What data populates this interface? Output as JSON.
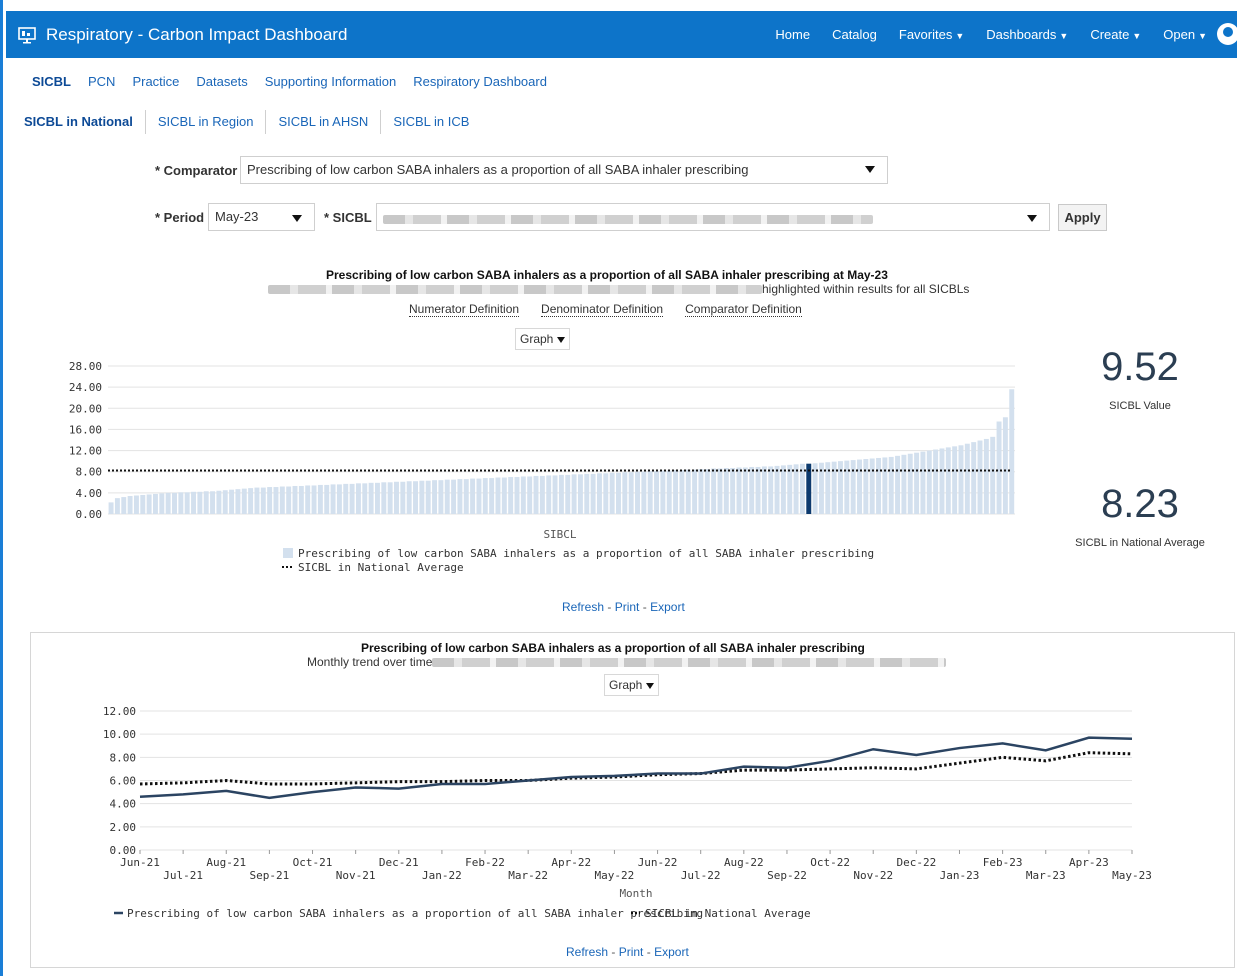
{
  "header": {
    "title": "Respiratory - Carbon Impact Dashboard",
    "nav": [
      "Home",
      "Catalog",
      "Favorites",
      "Dashboards",
      "Create",
      "Open"
    ]
  },
  "tabs": [
    "SICBL",
    "PCN",
    "Practice",
    "Datasets",
    "Supporting Information",
    "Respiratory Dashboard"
  ],
  "subtabs": [
    "SICBL in National",
    "SICBL in Region",
    "SICBL in AHSN",
    "SICBL in ICB"
  ],
  "filters": {
    "comparator_label": "* Comparator",
    "comparator_value": "Prescribing of low carbon SABA inhalers as a proportion of all SABA inhaler prescribing",
    "period_label": "* Period",
    "period_value": "May-23",
    "sicbl_label": "* SICBL",
    "apply_label": "Apply"
  },
  "chart1": {
    "title": "Prescribing of low carbon SABA inhalers as a proportion of all SABA inhaler prescribing at May-23",
    "subtitle_tail": "highlighted within results for all SICBLs",
    "links": [
      "Numerator Definition",
      "Denominator Definition",
      "Comparator Definition"
    ],
    "view_label": "Graph",
    "xlabel": "SIBCL",
    "legend": [
      "Prescribing of low carbon SABA inhalers as a proportion of all SABA inhaler prescribing",
      "SICBL in National Average"
    ],
    "footer": {
      "refresh": "Refresh",
      "print": "Print",
      "export": "Export"
    }
  },
  "kpis": {
    "value": "9.52",
    "value_label": "SICBL Value",
    "average": "8.23",
    "average_label": "SICBL in National Average"
  },
  "chart2": {
    "title": "Prescribing of low carbon SABA inhalers as a proportion of all SABA inhaler prescribing",
    "subtitle": "Monthly trend over time",
    "view_label": "Graph",
    "xlabel": "Month",
    "legend": [
      "Prescribing of low carbon SABA inhalers as a proportion of all SABA inhaler prescribing",
      "SICBL in National Average"
    ],
    "footer": {
      "refresh": "Refresh",
      "print": "Print",
      "export": "Export"
    }
  },
  "colors": {
    "header": "#0d74c9",
    "bar": "#d3e0ee",
    "highlight": "#0d3a6e",
    "line": "#2b4462",
    "avg": "#111111"
  },
  "chart_data": [
    {
      "type": "bar",
      "xlabel": "SIBCL",
      "ylim": [
        0,
        28
      ],
      "yticks": [
        "0.00",
        "4.00",
        "8.00",
        "12.00",
        "16.00",
        "20.00",
        "24.00",
        "28.00"
      ],
      "highlight_index": 110,
      "average": 8.23,
      "values": [
        2.2,
        3.0,
        3.2,
        3.4,
        3.5,
        3.6,
        3.7,
        3.8,
        3.9,
        4.0,
        4.0,
        4.1,
        4.1,
        4.2,
        4.2,
        4.3,
        4.3,
        4.4,
        4.5,
        4.6,
        4.7,
        4.8,
        4.9,
        5.0,
        5.0,
        5.1,
        5.1,
        5.2,
        5.2,
        5.3,
        5.3,
        5.4,
        5.4,
        5.5,
        5.5,
        5.6,
        5.6,
        5.7,
        5.7,
        5.8,
        5.8,
        5.9,
        5.9,
        6.0,
        6.0,
        6.1,
        6.1,
        6.2,
        6.2,
        6.3,
        6.3,
        6.4,
        6.4,
        6.5,
        6.5,
        6.6,
        6.6,
        6.7,
        6.7,
        6.8,
        6.8,
        6.9,
        6.9,
        7.0,
        7.0,
        7.1,
        7.1,
        7.2,
        7.2,
        7.3,
        7.3,
        7.4,
        7.4,
        7.5,
        7.5,
        7.6,
        7.6,
        7.7,
        7.7,
        7.8,
        7.8,
        7.9,
        7.9,
        8.0,
        8.0,
        8.1,
        8.1,
        8.2,
        8.2,
        8.3,
        8.3,
        8.4,
        8.4,
        8.5,
        8.5,
        8.6,
        8.6,
        8.7,
        8.7,
        8.8,
        8.8,
        8.9,
        8.9,
        9.0,
        9.0,
        9.1,
        9.2,
        9.3,
        9.4,
        9.5,
        9.52,
        9.6,
        9.7,
        9.8,
        9.9,
        10.0,
        10.1,
        10.2,
        10.3,
        10.4,
        10.5,
        10.6,
        10.7,
        10.8,
        11.0,
        11.2,
        11.4,
        11.6,
        11.8,
        12.0,
        12.2,
        12.4,
        12.6,
        12.8,
        13.0,
        13.3,
        13.6,
        13.9,
        14.2,
        14.6,
        17.5,
        18.3,
        23.6
      ]
    },
    {
      "type": "line",
      "xlabel": "Month",
      "ylim": [
        0,
        12
      ],
      "yticks": [
        "0.00",
        "2.00",
        "4.00",
        "6.00",
        "8.00",
        "10.00",
        "12.00"
      ],
      "x": [
        "Jun-21",
        "Jul-21",
        "Aug-21",
        "Sep-21",
        "Oct-21",
        "Nov-21",
        "Dec-21",
        "Jan-22",
        "Feb-22",
        "Mar-22",
        "Apr-22",
        "May-22",
        "Jun-22",
        "Jul-22",
        "Aug-22",
        "Sep-22",
        "Oct-22",
        "Nov-22",
        "Dec-22",
        "Jan-23",
        "Feb-23",
        "Mar-23",
        "Apr-23",
        "May-23"
      ],
      "series": [
        {
          "name": "Prescribing of low carbon SABA inhalers as a proportion of all SABA inhaler prescribing",
          "values": [
            4.6,
            4.8,
            5.1,
            4.5,
            5.0,
            5.4,
            5.3,
            5.7,
            5.7,
            6.0,
            6.3,
            6.4,
            6.6,
            6.6,
            7.2,
            7.1,
            7.7,
            8.7,
            8.2,
            8.8,
            9.2,
            8.6,
            9.7,
            9.6
          ]
        },
        {
          "name": "SICBL in National Average",
          "values": [
            5.7,
            5.8,
            6.0,
            5.7,
            5.7,
            5.8,
            5.9,
            5.9,
            6.0,
            6.0,
            6.2,
            6.3,
            6.5,
            6.6,
            6.9,
            6.9,
            7.0,
            7.1,
            7.0,
            7.5,
            8.0,
            7.7,
            8.4,
            8.3
          ]
        }
      ]
    }
  ]
}
